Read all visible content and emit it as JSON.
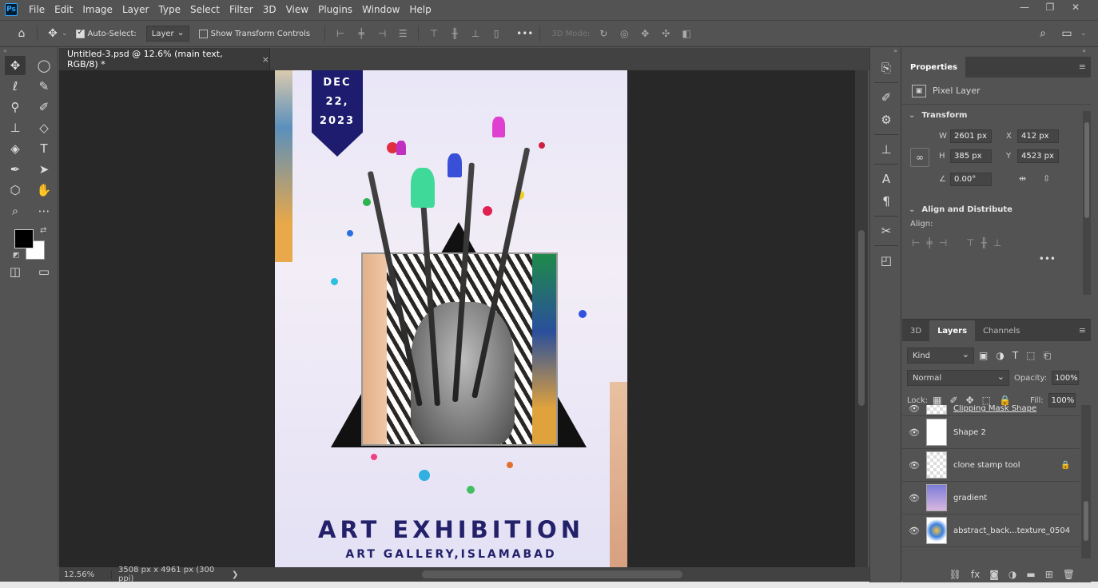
{
  "app": {
    "logo": "Ps",
    "menu": [
      "File",
      "Edit",
      "Image",
      "Layer",
      "Type",
      "Select",
      "Filter",
      "3D",
      "View",
      "Plugins",
      "Window",
      "Help"
    ],
    "window_controls": [
      "—",
      "❐",
      "✕"
    ]
  },
  "options_bar": {
    "home_icon": "home-icon",
    "move_icon": "move-icon",
    "auto_select_label": "Auto-Select:",
    "auto_select_checked": true,
    "auto_select_target": "Layer",
    "transform_controls_label": "Show Transform Controls",
    "transform_controls_checked": false,
    "more_label": "•••",
    "mode_3d_label": "3D Mode:"
  },
  "document": {
    "tab_title": "Untitled-3.psd @ 12.6% (main text, RGB/8) *",
    "close": "×",
    "zoom": "12.56%",
    "size_info": "3508 px x 4961 px (300 ppi)",
    "status_arrow": "❯"
  },
  "poster": {
    "date_line1": "DEC",
    "date_line2": "22,",
    "date_line3": "2023",
    "title": "ART EXHIBITION",
    "subtitle": "ART GALLERY,ISLAMABAD"
  },
  "properties": {
    "tab": "Properties",
    "layer_type": "Pixel Layer",
    "transform_header": "Transform",
    "w_label": "W",
    "w_value": "2601 px",
    "h_label": "H",
    "h_value": "385 px",
    "x_label": "X",
    "x_value": "412 px",
    "y_label": "Y",
    "y_value": "4523 px",
    "angle_value": "0.00°",
    "align_header": "Align and Distribute",
    "align_label": "Align:",
    "more": "•••"
  },
  "layers": {
    "tabs": [
      "3D",
      "Layers",
      "Channels"
    ],
    "active_tab": "Layers",
    "filter_kind": "Kind",
    "blend_mode": "Normal",
    "opacity_label": "Opacity:",
    "opacity_value": "100%",
    "lock_label": "Lock:",
    "fill_label": "Fill:",
    "fill_value": "100%",
    "items": [
      {
        "name": "Clipping Mask Shape",
        "locked": false
      },
      {
        "name": "Shape 2",
        "locked": false
      },
      {
        "name": "clone stamp tool",
        "locked": true
      },
      {
        "name": "gradient",
        "locked": false
      },
      {
        "name": "abstract_back...texture_0504",
        "locked": false
      }
    ]
  }
}
